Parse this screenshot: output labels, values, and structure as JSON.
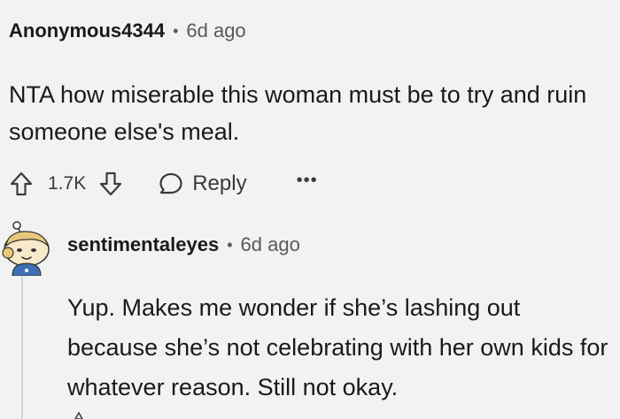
{
  "comment": {
    "author": "Anonymous4344",
    "separator": "•",
    "time": "6d ago",
    "body": "NTA how miserable this woman must be to try and ruin someone else's meal.",
    "actions": {
      "score": "1.7K",
      "reply_label": "Reply",
      "more_label": "•••",
      "upvote_icon": "arrow-up-icon",
      "downvote_icon": "arrow-down-icon",
      "reply_icon": "speech-bubble-icon"
    }
  },
  "reply": {
    "author": "sentimentaleyes",
    "separator": "•",
    "time": "6d ago",
    "avatar_icon": "snoo-avatar-icon",
    "body": "Yup. Makes me wonder if she’s lashing out because she’s not celebrating with her own kids for whatever reason. Still not okay."
  },
  "colors": {
    "background": "#f2f2f2",
    "text": "#1a1a1a",
    "meta": "#5a5a5a",
    "thread_line": "#d6d6d6"
  }
}
